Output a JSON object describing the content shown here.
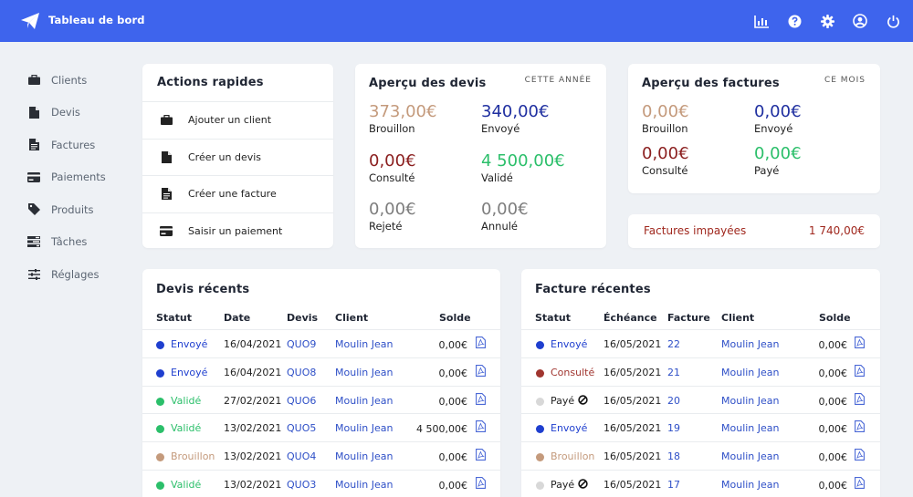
{
  "topbar": {
    "title": "Tableau de bord",
    "icons": [
      "paper-plane-icon",
      "chart-icon",
      "help-icon",
      "gear-icon",
      "user-icon",
      "power-icon"
    ]
  },
  "sidebar": {
    "items": [
      {
        "label": "Clients",
        "icon": "briefcase-icon"
      },
      {
        "label": "Devis",
        "icon": "file-icon"
      },
      {
        "label": "Factures",
        "icon": "file-text-icon"
      },
      {
        "label": "Paiements",
        "icon": "credit-card-icon"
      },
      {
        "label": "Produits",
        "icon": "tag-icon"
      },
      {
        "label": "Tâches",
        "icon": "tasks-icon"
      },
      {
        "label": "Réglages",
        "icon": "sliders-icon"
      }
    ]
  },
  "quick_actions": {
    "title": "Actions rapides",
    "items": [
      {
        "label": "Ajouter un client",
        "icon": "briefcase-icon"
      },
      {
        "label": "Créer un devis",
        "icon": "file-icon"
      },
      {
        "label": "Créer une facture",
        "icon": "file-text-icon"
      },
      {
        "label": "Saisir un paiement",
        "icon": "credit-card-icon"
      }
    ]
  },
  "quotes_overview": {
    "title": "Aperçu des devis",
    "period": "CETTE ANNÉE",
    "stats": [
      {
        "amount": "373,00€",
        "label": "Brouillon",
        "color": "#c49a7c"
      },
      {
        "amount": "340,00€",
        "label": "Envoyé",
        "color": "#1f2fa0"
      },
      {
        "amount": "0,00€",
        "label": "Consulté",
        "color": "#8b1f1f"
      },
      {
        "amount": "4 500,00€",
        "label": "Validé",
        "color": "#2bbf6a"
      },
      {
        "amount": "0,00€",
        "label": "Rejeté",
        "color": "#7d7d7d"
      },
      {
        "amount": "0,00€",
        "label": "Annulé",
        "color": "#7d7d7d"
      }
    ]
  },
  "invoices_overview": {
    "title": "Aperçu des factures",
    "period": "CE MOIS",
    "stats": [
      {
        "amount": "0,00€",
        "label": "Brouillon",
        "color": "#c49a7c"
      },
      {
        "amount": "0,00€",
        "label": "Envoyé",
        "color": "#1f2fa0"
      },
      {
        "amount": "0,00€",
        "label": "Consulté",
        "color": "#8b1f1f"
      },
      {
        "amount": "0,00€",
        "label": "Payé",
        "color": "#2bbf6a"
      }
    ]
  },
  "unpaid": {
    "label": "Factures impayées",
    "value": "1 740,00€"
  },
  "recent_quotes": {
    "title": "Devis récents",
    "headers": {
      "status": "Statut",
      "date": "Date",
      "number": "Devis",
      "client": "Client",
      "balance": "Solde"
    },
    "rows": [
      {
        "status": "Envoyé",
        "status_color": "#1f3fcf",
        "text_color": "#1f3fcf",
        "date": "16/04/2021",
        "number": "QUO9",
        "client": "Moulin Jean",
        "balance": "0,00€"
      },
      {
        "status": "Envoyé",
        "status_color": "#1f3fcf",
        "text_color": "#1f3fcf",
        "date": "16/04/2021",
        "number": "QUO8",
        "client": "Moulin Jean",
        "balance": "0,00€"
      },
      {
        "status": "Validé",
        "status_color": "#2bbf6a",
        "text_color": "#2bbf6a",
        "date": "27/02/2021",
        "number": "QUO6",
        "client": "Moulin Jean",
        "balance": "0,00€"
      },
      {
        "status": "Validé",
        "status_color": "#2bbf6a",
        "text_color": "#2bbf6a",
        "date": "13/02/2021",
        "number": "QUO5",
        "client": "Moulin Jean",
        "balance": "4 500,00€"
      },
      {
        "status": "Brouillon",
        "status_color": "#c49a7c",
        "text_color": "#c49a7c",
        "date": "13/02/2021",
        "number": "QUO4",
        "client": "Moulin Jean",
        "balance": "0,00€"
      },
      {
        "status": "Validé",
        "status_color": "#2bbf6a",
        "text_color": "#2bbf6a",
        "date": "13/02/2021",
        "number": "QUO3",
        "client": "Moulin Jean",
        "balance": "0,00€"
      }
    ]
  },
  "recent_invoices": {
    "title": "Facture récentes",
    "headers": {
      "status": "Statut",
      "due": "Échéance",
      "number": "Facture",
      "client": "Client",
      "balance": "Solde"
    },
    "rows": [
      {
        "status": "Envoyé",
        "status_color": "#1f3fcf",
        "text_color": "#1f3fcf",
        "due": "16/05/2021",
        "number": "22",
        "client": "Moulin Jean",
        "balance": "0,00€",
        "blocked": false
      },
      {
        "status": "Consulté",
        "status_color": "#a0352f",
        "text_color": "#a0352f",
        "due": "16/05/2021",
        "number": "21",
        "client": "Moulin Jean",
        "balance": "0,00€",
        "blocked": false
      },
      {
        "status": "Payé",
        "status_color": "#d8d8d8",
        "text_color": "#222222",
        "due": "16/05/2021",
        "number": "20",
        "client": "Moulin Jean",
        "balance": "0,00€",
        "blocked": true
      },
      {
        "status": "Envoyé",
        "status_color": "#1f3fcf",
        "text_color": "#1f3fcf",
        "due": "16/05/2021",
        "number": "19",
        "client": "Moulin Jean",
        "balance": "0,00€",
        "blocked": false
      },
      {
        "status": "Brouillon",
        "status_color": "#c49a7c",
        "text_color": "#c49a7c",
        "due": "16/05/2021",
        "number": "18",
        "client": "Moulin Jean",
        "balance": "0,00€",
        "blocked": false
      },
      {
        "status": "Payé",
        "status_color": "#d8d8d8",
        "text_color": "#222222",
        "due": "16/05/2021",
        "number": "17",
        "client": "Moulin Jean",
        "balance": "0,00€",
        "blocked": true
      }
    ]
  }
}
